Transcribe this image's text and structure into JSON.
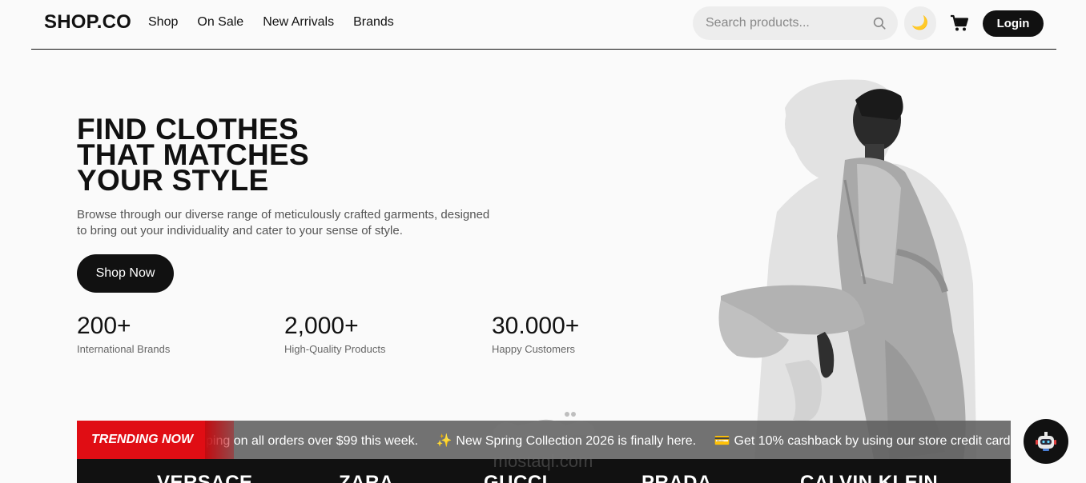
{
  "navbar": {
    "logo": "SHOP.CO",
    "links": [
      "Shop",
      "On Sale",
      "New Arrivals",
      "Brands"
    ],
    "search_placeholder": "Search products...",
    "theme_icon": "moon-icon",
    "cart_icon": "cart-icon",
    "login_label": "Login"
  },
  "hero": {
    "title_lines": [
      "FIND CLOTHES",
      "THAT MATCHES",
      "YOUR STYLE"
    ],
    "description": "Browse through our diverse range of meticulously crafted garments, designed to bring out your individuality and cater to your sense of style.",
    "cta_label": "Shop Now",
    "stats": [
      {
        "value": "200+",
        "label": "International Brands"
      },
      {
        "value": "2,000+",
        "label": "High-Quality Products"
      },
      {
        "value": "30.000+",
        "label": "Happy Customers"
      }
    ]
  },
  "trending": {
    "label": "TRENDING NOW",
    "items": [
      {
        "icon": "",
        "text": "ping on all orders over $99 this week."
      },
      {
        "icon": "sparkles-icon",
        "glyph": "✨",
        "text": "New Spring Collection 2026 is finally here."
      },
      {
        "icon": "credit-card-icon",
        "glyph": "💳",
        "text": "Get 10% cashback by using our store credit card."
      }
    ],
    "colors": {
      "label_bg": "#e00d14",
      "bar_bg": "#5f5f5f"
    }
  },
  "brands": [
    "VERSACE",
    "ZARA",
    "GUCCI",
    "PRADA",
    "CALVIN KLEIN"
  ],
  "watermark": {
    "text": "mostaql.com"
  },
  "chatbot": {
    "icon": "robot-icon"
  }
}
